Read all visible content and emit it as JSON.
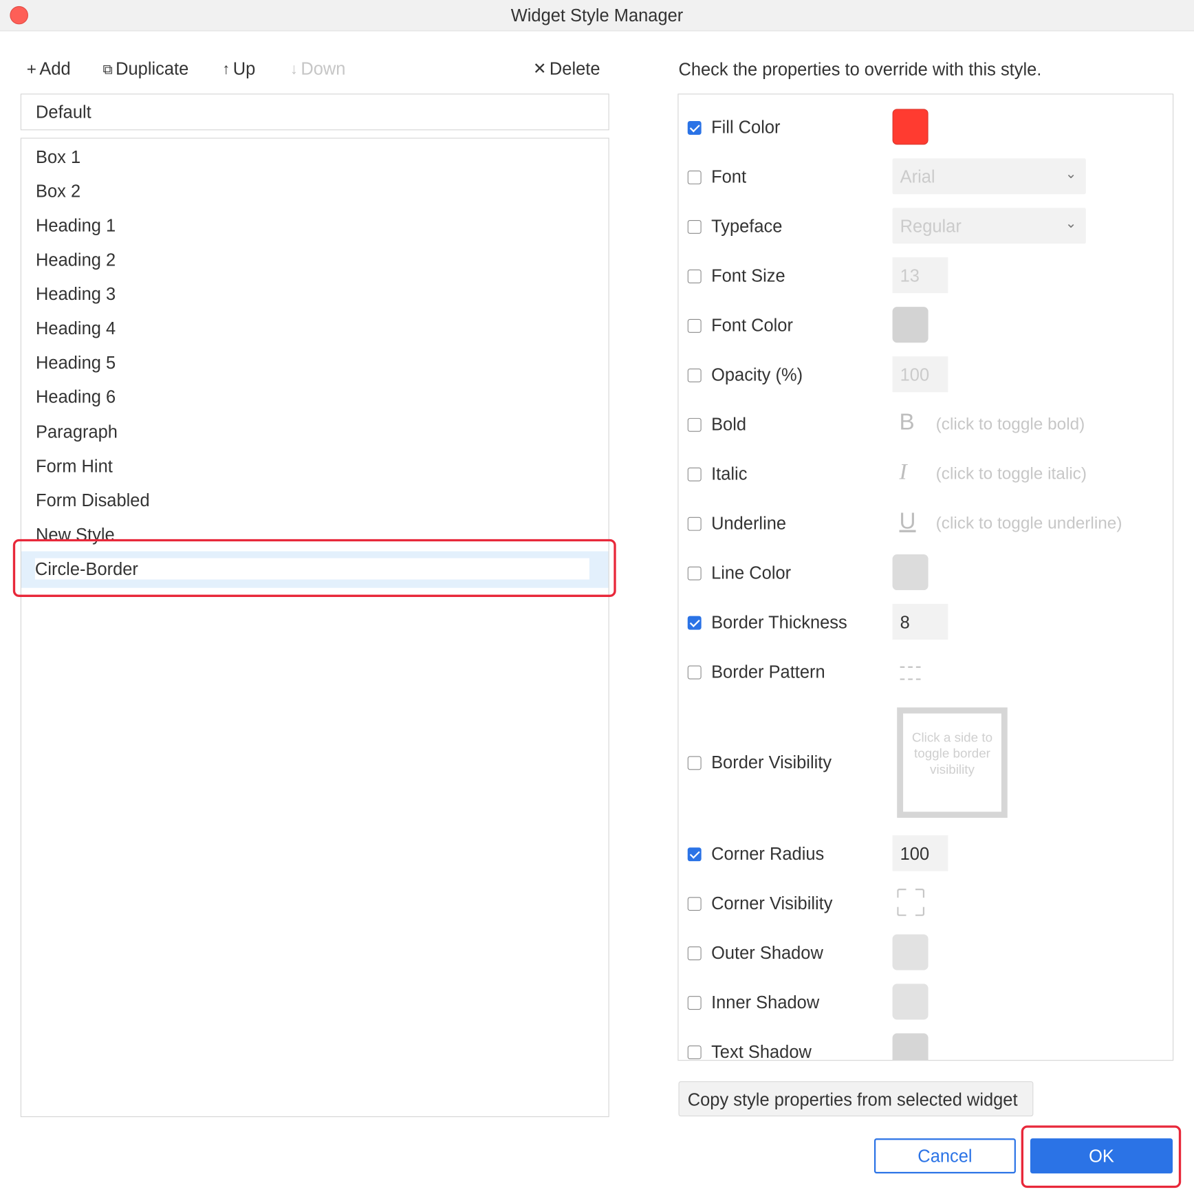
{
  "window": {
    "title": "Widget Style Manager"
  },
  "toolbar": {
    "add_label": "Add",
    "duplicate_label": "Duplicate",
    "up_label": "Up",
    "down_label": "Down",
    "delete_label": "Delete"
  },
  "styles": {
    "default": "Default",
    "items": [
      "Box 1",
      "Box 2",
      "Heading 1",
      "Heading 2",
      "Heading 3",
      "Heading 4",
      "Heading 5",
      "Heading 6",
      "Paragraph",
      "Form Hint",
      "Form Disabled",
      "New Style"
    ],
    "selected_editing": "Circle-Border"
  },
  "properties": {
    "instruction": "Check the properties to override with this style.",
    "fill_color": {
      "label": "Fill Color",
      "checked": true,
      "color": "#ff3b30"
    },
    "font": {
      "label": "Font",
      "checked": false,
      "value": "Arial"
    },
    "typeface": {
      "label": "Typeface",
      "checked": false,
      "value": "Regular"
    },
    "font_size": {
      "label": "Font Size",
      "checked": false,
      "value": "13"
    },
    "font_color": {
      "label": "Font Color",
      "checked": false,
      "color": "#d3d3d3"
    },
    "opacity": {
      "label": "Opacity (%)",
      "checked": false,
      "value": "100"
    },
    "bold": {
      "label": "Bold",
      "checked": false,
      "glyph": "B",
      "hint": "(click to toggle bold)"
    },
    "italic": {
      "label": "Italic",
      "checked": false,
      "glyph": "I",
      "hint": "(click to toggle italic)"
    },
    "underline": {
      "label": "Underline",
      "checked": false,
      "glyph": "U",
      "hint": "(click to toggle underline)"
    },
    "line_color": {
      "label": "Line Color",
      "checked": false,
      "color": "#dcdcdc"
    },
    "border_thickness": {
      "label": "Border Thickness",
      "checked": true,
      "value": "8"
    },
    "border_pattern": {
      "label": "Border Pattern",
      "checked": false,
      "icon": "dashed-line-icon"
    },
    "border_visibility": {
      "label": "Border Visibility",
      "checked": false,
      "hint": "Click a side to toggle border visibility"
    },
    "corner_radius": {
      "label": "Corner Radius",
      "checked": true,
      "value": "100"
    },
    "corner_visibility": {
      "label": "Corner Visibility",
      "checked": false,
      "icon": "corners-icon"
    },
    "outer_shadow": {
      "label": "Outer Shadow",
      "checked": false,
      "color": "#e2e2e2"
    },
    "inner_shadow": {
      "label": "Inner Shadow",
      "checked": false,
      "color": "#e2e2e2"
    },
    "text_shadow": {
      "label": "Text Shadow",
      "checked": false,
      "color": "#d6d6d6"
    }
  },
  "footer": {
    "copy_label": "Copy style properties from selected widget",
    "cancel_label": "Cancel",
    "ok_label": "OK"
  },
  "colors": {
    "accent": "#2b73e6",
    "highlight": "#e8283a",
    "selection": "#e3f0fc"
  }
}
